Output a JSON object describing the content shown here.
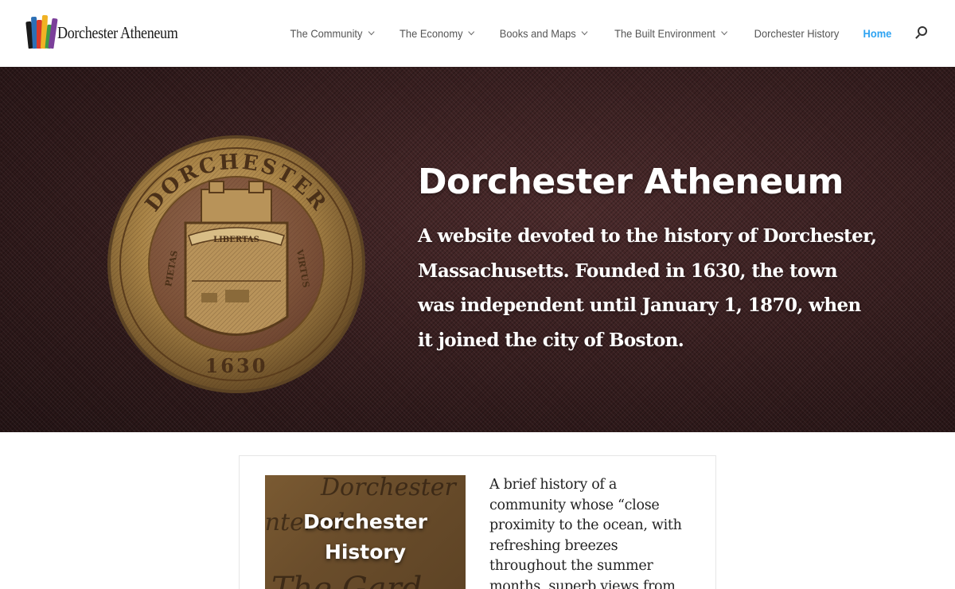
{
  "site": {
    "logo_text": "Dorchester Atheneum"
  },
  "nav": {
    "items": [
      {
        "label": "The Community",
        "has_dropdown": true
      },
      {
        "label": "The Economy",
        "has_dropdown": true
      },
      {
        "label": "Books and Maps",
        "has_dropdown": true
      },
      {
        "label": "The Built Environment",
        "has_dropdown": true
      },
      {
        "label": "Dorchester History",
        "has_dropdown": false
      },
      {
        "label": "Home",
        "has_dropdown": false,
        "active": true
      }
    ],
    "search_icon": "search-icon",
    "active_color": "#2ea3f2"
  },
  "hero": {
    "title": "Dorchester Atheneum",
    "subtitle": "A website devoted to the history of Dorchester, Massachusetts. Founded in 1630, the town was independent until January 1, 1870, when it joined the city of Boston.",
    "seal": {
      "top_text": "DORCHESTER",
      "banner_text": "LIBERTAS",
      "left_text": "PIETAS",
      "right_text": "VIRTUS",
      "year": "1630"
    }
  },
  "card": {
    "image_label": "Dorchester History",
    "image_script": [
      "Dorchester",
      "entered",
      "The Gard"
    ],
    "text": "A brief history of a community whose “close proximity to the ocean, with refreshing breezes throughout the summer months, superb views from"
  },
  "colors": {
    "hero_bg": "#3a1f20",
    "seal_gold": "#b08a4a",
    "text_dark": "#222222"
  }
}
